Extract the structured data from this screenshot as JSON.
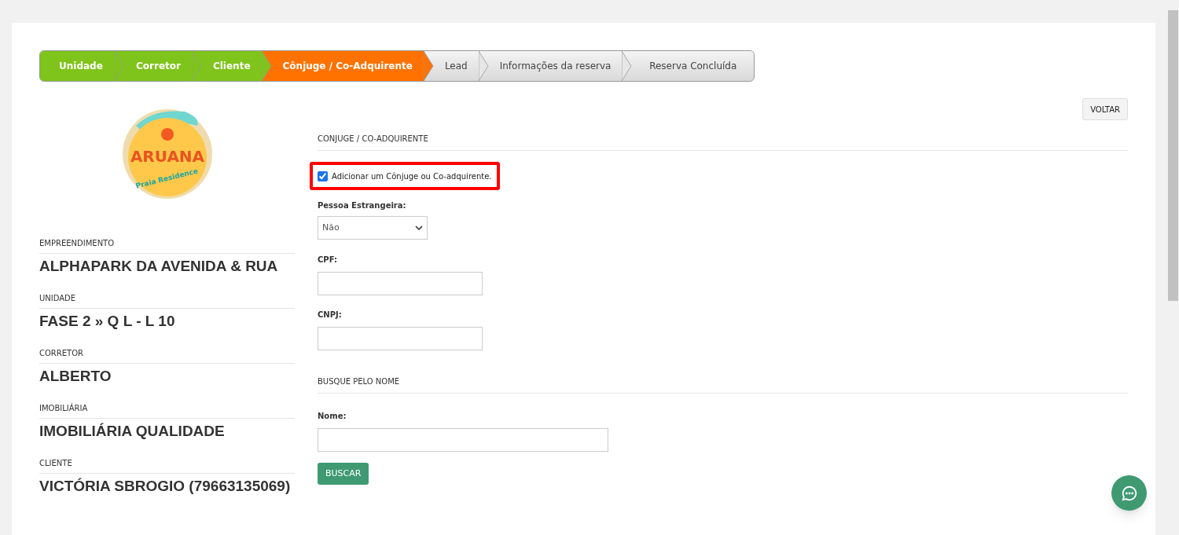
{
  "steps": [
    {
      "label": "Unidade",
      "completed": true,
      "selected": false
    },
    {
      "label": "Corretor",
      "completed": true,
      "selected": false
    },
    {
      "label": "Cliente",
      "completed": true,
      "selected": false
    },
    {
      "label": "Cônjuge / Co-Adquirente",
      "completed": false,
      "selected": true
    },
    {
      "label": "Lead",
      "completed": false,
      "selected": false
    },
    {
      "label": "Informações da reserva",
      "completed": false,
      "selected": false
    },
    {
      "label": "Reserva Concluída",
      "completed": false,
      "selected": false
    }
  ],
  "back_button": "VOLTAR",
  "logo": {
    "title": "ARUANA",
    "subtitle": "Praia Residence"
  },
  "summary": [
    {
      "label": "EMPREENDIMENTO",
      "value": "ALPHAPARK DA AVENIDA & RUA"
    },
    {
      "label": "UNIDADE",
      "value": "FASE 2 » Q L - L 10"
    },
    {
      "label": "CORRETOR",
      "value": "ALBERTO"
    },
    {
      "label": "IMOBILIÁRIA",
      "value": "IMOBILIÁRIA QUALIDADE"
    },
    {
      "label": "CLIENTE",
      "value": "VICTÓRIA SBROGIO (79663135069)"
    }
  ],
  "spouse_section": {
    "title": "CONJUGE / CO-ADQUIRENTE",
    "add_checkbox": {
      "label": "Adicionar um Cônjuge ou Co-adquirente.",
      "checked": true,
      "highlighted": true
    },
    "foreigner": {
      "label": "Pessoa Estrangeira:",
      "value": "Não"
    },
    "cpf": {
      "label": "CPF:"
    },
    "cnpj": {
      "label": "CNPJ:"
    }
  },
  "search_section": {
    "title": "BUSQUE PELO NOME",
    "name": {
      "label": "Nome:"
    },
    "button": "BUSCAR"
  }
}
